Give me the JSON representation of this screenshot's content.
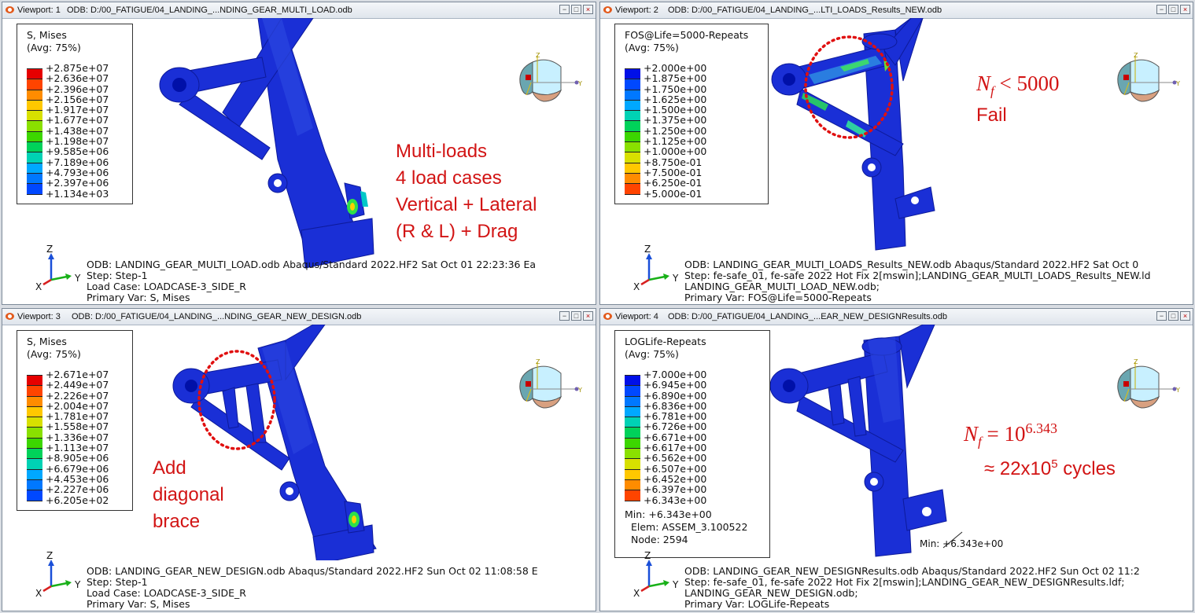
{
  "viewports": [
    {
      "name": "Viewport: 1",
      "odb_title": "ODB: D:/00_FATIGUE/04_LANDING_...NDING_GEAR_MULTI_LOAD.odb",
      "legend": {
        "title1": "S, Mises",
        "title2": "(Avg: 75%)",
        "values": [
          "+2.875e+07",
          "+2.636e+07",
          "+2.396e+07",
          "+2.156e+07",
          "+1.917e+07",
          "+1.677e+07",
          "+1.438e+07",
          "+1.198e+07",
          "+9.585e+06",
          "+7.189e+06",
          "+4.793e+06",
          "+2.397e+06",
          "+1.134e+03"
        ]
      },
      "info_lines": [
        "ODB: LANDING_GEAR_MULTI_LOAD.odb    Abaqus/Standard 2022.HF2    Sat Oct 01 22:23:36 Ea",
        "Step: Step-1",
        "Load Case: LOADCASE-3_SIDE_R",
        "Primary Var: S, Mises"
      ],
      "annotation": [
        "Multi-loads",
        "4 load cases",
        "Vertical + Lateral",
        "(R & L) + Drag"
      ]
    },
    {
      "name": "Viewport: 2",
      "odb_title": "ODB: D:/00_FATIGUE/04_LANDING_...LTI_LOADS_Results_NEW.odb",
      "legend": {
        "title1": "FOS@Life=5000-Repeats",
        "title2": "(Avg: 75%)",
        "values": [
          "+2.000e+00",
          "+1.875e+00",
          "+1.750e+00",
          "+1.625e+00",
          "+1.500e+00",
          "+1.375e+00",
          "+1.250e+00",
          "+1.125e+00",
          "+1.000e+00",
          "+8.750e-01",
          "+7.500e-01",
          "+6.250e-01",
          "+5.000e-01"
        ]
      },
      "info_lines": [
        "ODB: LANDING_GEAR_MULTI_LOADS_Results_NEW.odb    Abaqus/Standard 2022.HF2    Sat Oct 0",
        "Step: fe-safe_01, fe-safe 2022 Hot Fix 2[mswin];LANDING_GEAR_MULTI_LOADS_Results_NEW.ld",
        "LANDING_GEAR_MULTI_LOAD_NEW.odb;",
        "Primary Var: FOS@Life=5000-Repeats"
      ],
      "annotation": {
        "nf_base": "N",
        "nf_sub": "f",
        "relation": "< 5000",
        "word": "Fail"
      }
    },
    {
      "name": "Viewport: 3",
      "odb_title": "ODB: D:/00_FATIGUE/04_LANDING_...NDING_GEAR_NEW_DESIGN.odb",
      "legend": {
        "title1": "S, Mises",
        "title2": "(Avg: 75%)",
        "values": [
          "+2.671e+07",
          "+2.449e+07",
          "+2.226e+07",
          "+2.004e+07",
          "+1.781e+07",
          "+1.558e+07",
          "+1.336e+07",
          "+1.113e+07",
          "+8.905e+06",
          "+6.679e+06",
          "+4.453e+06",
          "+2.227e+06",
          "+6.205e+02"
        ]
      },
      "info_lines": [
        "ODB: LANDING_GEAR_NEW_DESIGN.odb    Abaqus/Standard 2022.HF2    Sun Oct 02 11:08:58 E",
        "Step: Step-1",
        "Load Case: LOADCASE-3_SIDE_R",
        "Primary Var: S, Mises"
      ],
      "annotation": [
        "Add",
        "diagonal",
        "brace"
      ]
    },
    {
      "name": "Viewport: 4",
      "odb_title": "ODB: D:/00_FATIGUE/04_LANDING_...EAR_NEW_DESIGNResults.odb",
      "legend": {
        "title1": "LOGLife-Repeats",
        "title2": "(Avg: 75%)",
        "values": [
          "+7.000e+00",
          "+6.945e+00",
          "+6.890e+00",
          "+6.836e+00",
          "+6.781e+00",
          "+6.726e+00",
          "+6.671e+00",
          "+6.617e+00",
          "+6.562e+00",
          "+6.507e+00",
          "+6.452e+00",
          "+6.397e+00",
          "+6.343e+00"
        ],
        "min_line": "Min: +6.343e+00",
        "elem_line": "Elem: ASSEM_3.100522",
        "node_line": "Node: 2594"
      },
      "min_marker": "Min: +6.343e+00",
      "info_lines": [
        "ODB: LANDING_GEAR_NEW_DESIGNResults.odb    Abaqus/Standard 2022.HF2    Sun Oct 02 11:2",
        "Step: fe-safe_01, fe-safe 2022 Hot Fix 2[mswin];LANDING_GEAR_NEW_DESIGNResults.ldf;",
        "LANDING_GEAR_NEW_DESIGN.odb;",
        "Primary Var: LOGLife-Repeats"
      ],
      "annotation": {
        "nf_base": "N",
        "nf_sub": "f",
        "equals": "= 10",
        "exp": "6.343",
        "line2_pre": "≈ 22x10",
        "line2_exp": "5",
        "line2_post": " cycles"
      }
    }
  ],
  "window_buttons": {
    "minimize": "−",
    "restore": "□",
    "close": "×"
  },
  "triad": {
    "z": "Z",
    "x": "X",
    "y": "Y"
  },
  "view_cube": {
    "z": "Z",
    "y": "Y"
  },
  "colors": {
    "legend_scale": [
      "#e60000",
      "#ff4400",
      "#ff8c00",
      "#ffc800",
      "#d8e000",
      "#8ae000",
      "#3cd600",
      "#00d25a",
      "#00d2b4",
      "#00a8ff",
      "#0078ff",
      "#0048ff",
      "#0010e8"
    ],
    "part_blue": "#1a2fd6",
    "annotation_red": "#d21414"
  }
}
